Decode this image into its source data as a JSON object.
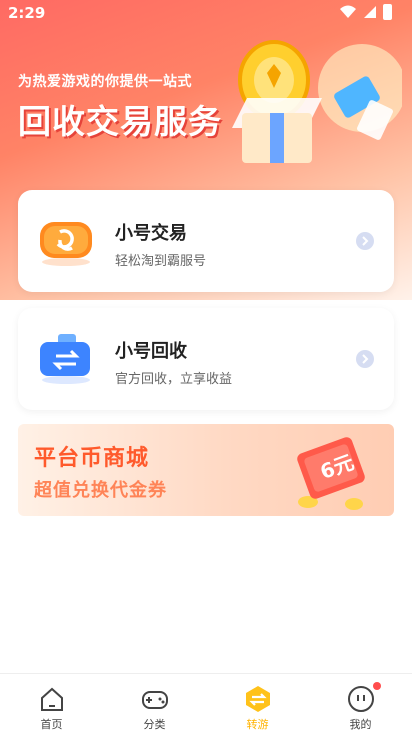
{
  "status_bar": {
    "time": "2:29"
  },
  "hero": {
    "subtitle": "为热爱游戏的你提供一站式",
    "title": "回收交易服务"
  },
  "cards": [
    {
      "title": "小号交易",
      "subtitle": "轻松淘到霸服号",
      "icon": "gamepad-icon"
    },
    {
      "title": "小号回收",
      "subtitle": "官方回收，立享收益",
      "icon": "wallet-icon"
    }
  ],
  "banner": {
    "line1": "平台币商城",
    "line2": "超值兑换代金券",
    "ticket_text": "6元"
  },
  "tabbar": {
    "items": [
      {
        "label": "首页",
        "icon": "home-icon"
      },
      {
        "label": "分类",
        "icon": "controller-icon"
      },
      {
        "label": "转游",
        "icon": "swap-icon",
        "active": true
      },
      {
        "label": "我的",
        "icon": "profile-icon",
        "badge": true
      }
    ]
  },
  "colors": {
    "accent": "#ffb300",
    "hero": "#ff6a63",
    "banner_text": "#ff5a2c"
  }
}
